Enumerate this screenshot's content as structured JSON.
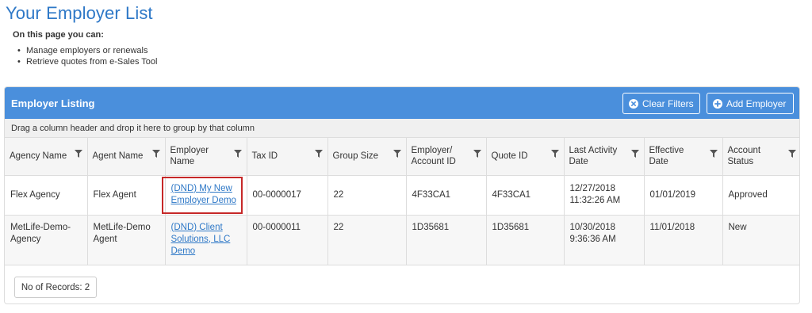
{
  "page": {
    "title": "Your Employer List",
    "intro_heading": "On this page you can:",
    "intro_items": [
      "Manage employers or renewals",
      "Retrieve quotes from e-Sales Tool"
    ]
  },
  "panel": {
    "title": "Employer Listing",
    "clear_filters_label": "Clear Filters",
    "clear_filters_icon": "close-circle-icon",
    "add_employer_label": "Add Employer",
    "add_employer_icon": "plus-circle-icon",
    "accent_color": "#4a8fdc"
  },
  "group_bar": {
    "text": "Drag a column header and drop it here to group by that column"
  },
  "grid": {
    "columns": [
      {
        "label": "Agency Name"
      },
      {
        "label": "Agent Name"
      },
      {
        "label": "Employer Name"
      },
      {
        "label": "Tax ID"
      },
      {
        "label": "Group Size"
      },
      {
        "label": "Employer/ Account ID"
      },
      {
        "label": "Quote ID"
      },
      {
        "label": "Last Activity Date"
      },
      {
        "label": "Effective Date"
      },
      {
        "label": "Account Status"
      }
    ],
    "rows": [
      {
        "agency": "Flex Agency",
        "agent": "Flex Agent",
        "employer": "(DND) My New Employer Demo",
        "tax_id": "00-0000017",
        "group_size": "22",
        "account_id": "4F33CA1",
        "quote_id": "4F33CA1",
        "last_activity": "12/27/2018 11:32:26 AM",
        "effective_date": "01/01/2019",
        "status": "Approved"
      },
      {
        "agency": "MetLife-Demo-Agency",
        "agent": "MetLife-Demo Agent",
        "employer": "(DND) Client Solutions, LLC Demo",
        "tax_id": "00-0000011",
        "group_size": "22",
        "account_id": "1D35681",
        "quote_id": "1D35681",
        "last_activity": "10/30/2018 9:36:36 AM",
        "effective_date": "11/01/2018",
        "status": "New"
      }
    ]
  },
  "footer": {
    "records_label": "No of Records: 2"
  }
}
